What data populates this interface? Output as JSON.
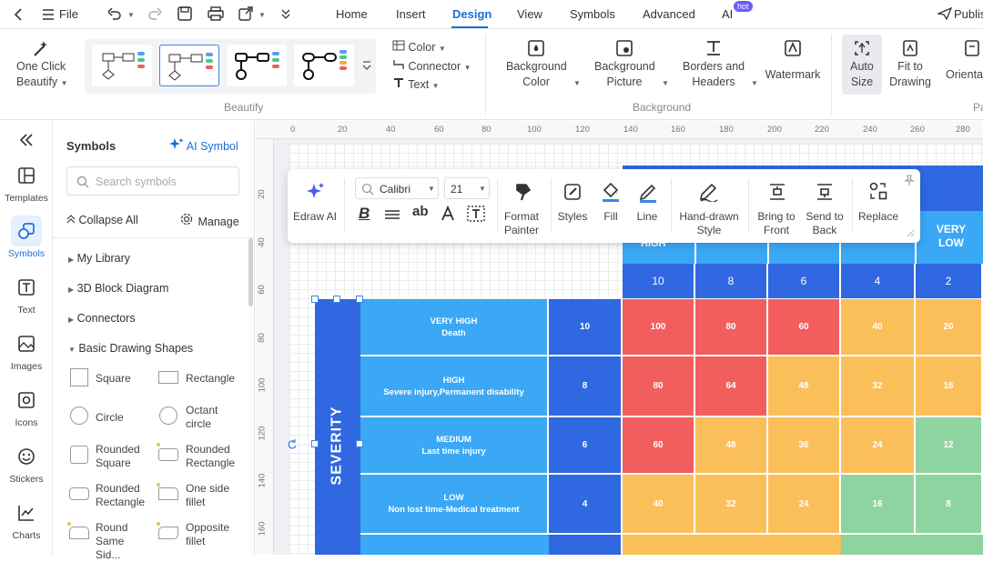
{
  "menubar": {
    "file": "File",
    "tabs": [
      "Home",
      "Insert",
      "Design",
      "View",
      "Symbols",
      "Advanced",
      "AI"
    ],
    "active_tab": "Design",
    "hot_badge": "hot",
    "publish": "Publis"
  },
  "ribbon": {
    "one_click_beautify": [
      "One Click",
      "Beautify"
    ],
    "beautify_group": "Beautify",
    "color": "Color",
    "connector": "Connector",
    "text": "Text",
    "background_color": [
      "Background",
      "Color"
    ],
    "background_picture": [
      "Background",
      "Picture"
    ],
    "borders_headers": [
      "Borders and",
      "Headers"
    ],
    "watermark": "Watermark",
    "background_group": "Background",
    "auto_size": [
      "Auto",
      "Size"
    ],
    "fit_to_drawing": [
      "Fit to",
      "Drawing"
    ],
    "orientation": "Orientat",
    "page_group_partial": "Pa"
  },
  "rail": {
    "items": [
      "Templates",
      "Symbols",
      "Text",
      "Images",
      "Icons",
      "Stickers",
      "Charts"
    ],
    "active": "Symbols"
  },
  "panel": {
    "title": "Symbols",
    "ai_symbol": "AI Symbol",
    "search_placeholder": "Search symbols",
    "collapse_all": "Collapse All",
    "manage": "Manage",
    "categories": [
      "My Library",
      "3D Block Diagram",
      "Connectors",
      "Basic Drawing Shapes"
    ],
    "shapes": [
      [
        "Square",
        "Rectangle"
      ],
      [
        "Circle",
        "Octant circle"
      ],
      [
        "Rounded Square",
        "Rounded Rectangle"
      ],
      [
        "Rounded Rectangle",
        "One side fillet"
      ],
      [
        "Round Same Sid...",
        "Opposite fillet"
      ]
    ]
  },
  "rulers": {
    "top": [
      "0",
      "20",
      "40",
      "60",
      "80",
      "100",
      "120",
      "140",
      "160",
      "180",
      "200",
      "220",
      "240",
      "260",
      "280"
    ],
    "left": [
      "20",
      "40",
      "60",
      "80",
      "100",
      "120",
      "140",
      "160"
    ]
  },
  "floating_toolbar": {
    "edraw_ai": "Edraw AI",
    "font": "Calibri",
    "size": "21",
    "format_painter": [
      "Format",
      "Painter"
    ],
    "styles": "Styles",
    "fill": "Fill",
    "line": "Line",
    "hand_drawn": [
      "Hand-drawn",
      "Style"
    ],
    "bring_front": [
      "Bring to",
      "Front"
    ],
    "send_back": [
      "Send to",
      "Back"
    ],
    "replace": "Replace"
  },
  "matrix": {
    "severity_label": "SEVERITY",
    "header_partial": "HIGH",
    "header_very_low": [
      "VERY",
      "LOW"
    ],
    "likelihood_values": [
      "10",
      "8",
      "6",
      "4",
      "2"
    ],
    "rows": [
      {
        "title": "VERY HIGH",
        "desc": "Death",
        "value": "10",
        "cells": [
          "100",
          "80",
          "60",
          "40",
          "20"
        ]
      },
      {
        "title": "HIGH",
        "desc": "Severe injury,Permanent disability",
        "value": "8",
        "cells": [
          "80",
          "64",
          "48",
          "32",
          "16"
        ]
      },
      {
        "title": "MEDIUM",
        "desc": "Last time injury",
        "value": "6",
        "cells": [
          "60",
          "48",
          "36",
          "24",
          "12"
        ]
      },
      {
        "title": "LOW",
        "desc": "Non lost time-Medical treatment",
        "value": "4",
        "cells": [
          "40",
          "32",
          "24",
          "16",
          "8"
        ]
      }
    ],
    "colors": {
      "red": "#f25d5d",
      "orange": "#fbbf5a",
      "yellow": "#f2d34a",
      "green": "#8ed4a0",
      "blue_dark": "#2f68e0",
      "blue_light": "#3aa8f5"
    }
  }
}
